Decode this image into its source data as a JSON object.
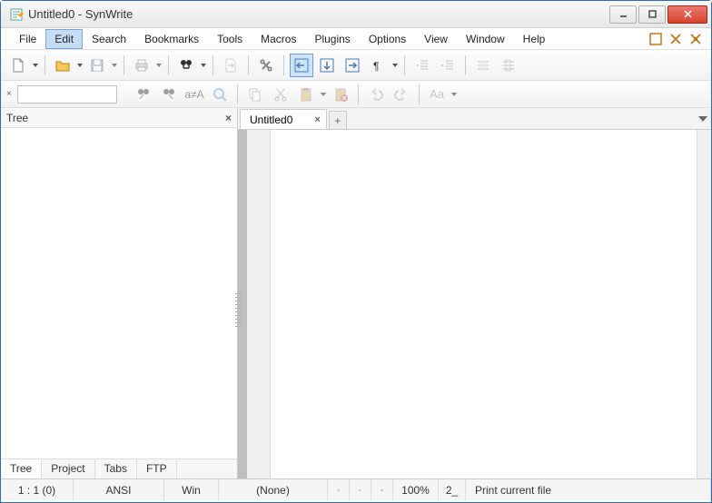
{
  "window": {
    "title": "Untitled0 - SynWrite"
  },
  "menu": {
    "items": [
      "File",
      "Edit",
      "Search",
      "Bookmarks",
      "Tools",
      "Macros",
      "Plugins",
      "Options",
      "View",
      "Window",
      "Help"
    ],
    "active_index": 1
  },
  "toolbar2": {
    "search_value": ""
  },
  "left_panel": {
    "title": "Tree",
    "tabs": [
      "Tree",
      "Project",
      "Tabs",
      "FTP"
    ],
    "active_tab": 0
  },
  "editor": {
    "tabs": [
      {
        "label": "Untitled0"
      }
    ],
    "new_tab_label": "+"
  },
  "status": {
    "pos": "1 : 1 (0)",
    "encoding": "ANSI",
    "lineend": "Win",
    "syntax": "(None)",
    "zoom": "100%",
    "ins": "2_",
    "hint": "Print current file"
  },
  "icons": {
    "minimize": "min",
    "maximize": "max",
    "close": "x"
  }
}
